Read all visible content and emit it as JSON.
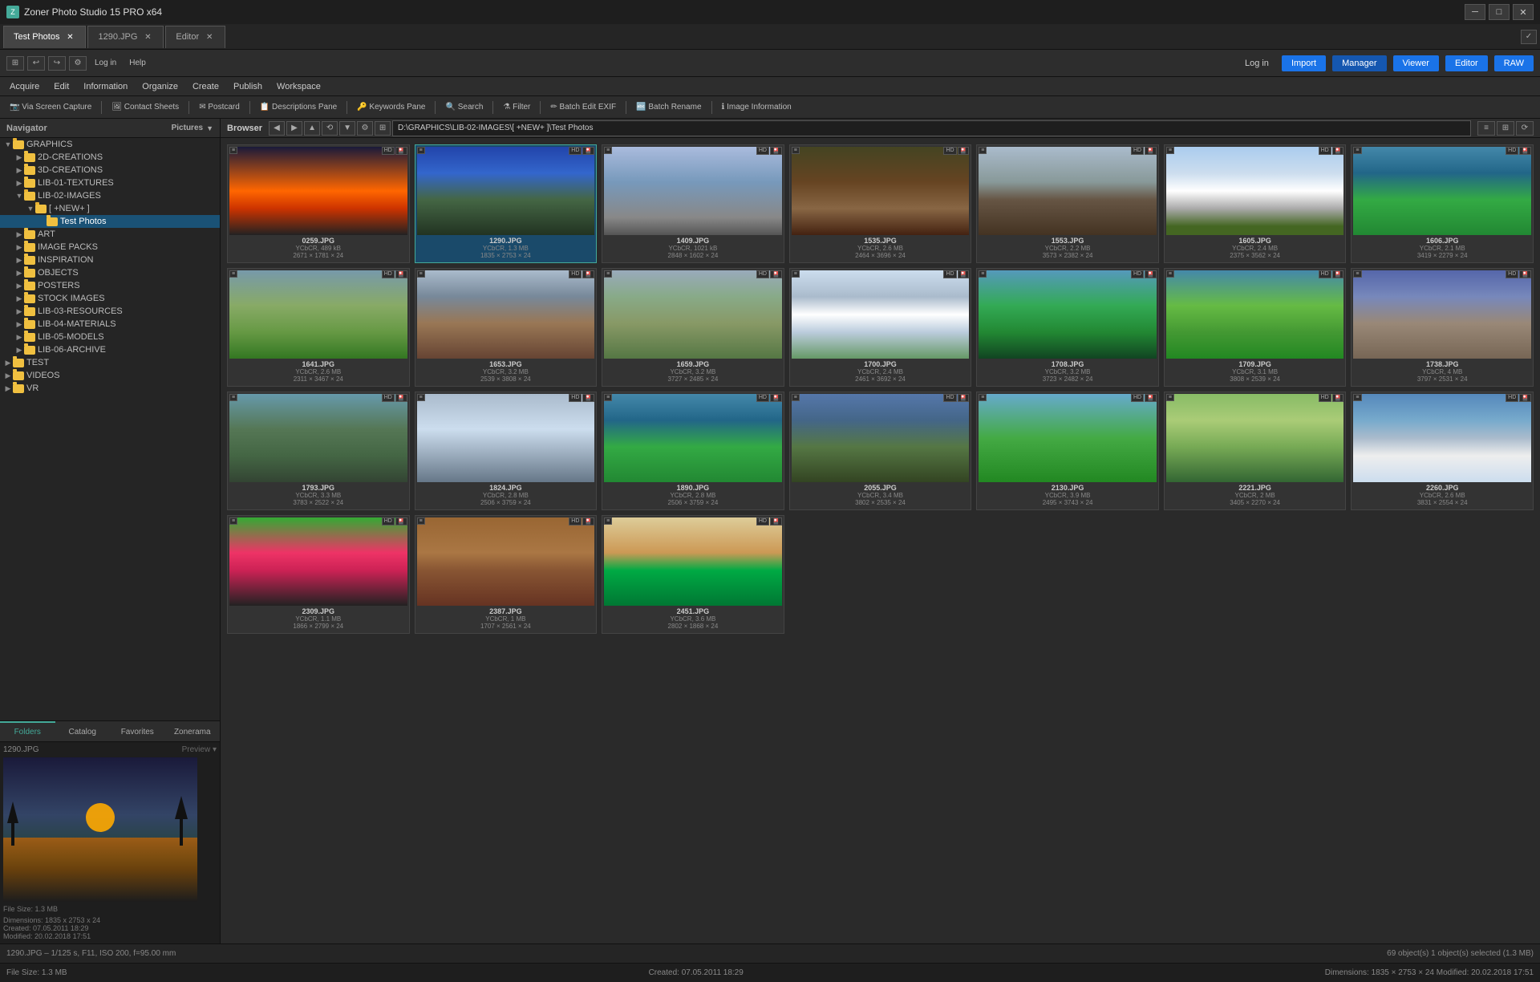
{
  "app": {
    "title": "Zoner Photo Studio 15 PRO x64",
    "icon": "Z"
  },
  "titlebar": {
    "minimize": "─",
    "maximize": "□",
    "close": "✕"
  },
  "tabs": [
    {
      "id": "test-photos",
      "label": "Test Photos",
      "active": true
    },
    {
      "id": "1290jpg",
      "label": "1290.JPG",
      "active": false
    },
    {
      "id": "editor",
      "label": "Editor",
      "active": false
    }
  ],
  "top_toolbar": {
    "log_in": "Log in",
    "import": "Import",
    "manager": "Manager",
    "viewer": "Viewer",
    "editor": "Editor",
    "raw": "RAW"
  },
  "menubar": {
    "items": [
      "Acquire",
      "Edit",
      "Information",
      "Organize",
      "Create",
      "Publish",
      "Workspace"
    ]
  },
  "action_toolbar": {
    "items": [
      "Via Screen Capture",
      "Contact Sheets",
      "Postcard",
      "Descriptions Pane",
      "Keywords Pane",
      "Search",
      "Filter",
      "Batch Edit EXIF",
      "Batch Rename",
      "Image Information"
    ]
  },
  "sidebar": {
    "navigator_label": "Navigator",
    "pictures_label": "Pictures",
    "tree": [
      {
        "indent": 0,
        "label": "GRAPHICS",
        "expanded": true,
        "selected": false,
        "arrow": "▼"
      },
      {
        "indent": 1,
        "label": "2D-CREATIONS",
        "expanded": false,
        "selected": false,
        "arrow": "▶"
      },
      {
        "indent": 1,
        "label": "3D-CREATIONS",
        "expanded": false,
        "selected": false,
        "arrow": "▶"
      },
      {
        "indent": 1,
        "label": "LIB-01-TEXTURES",
        "expanded": false,
        "selected": false,
        "arrow": "▶"
      },
      {
        "indent": 1,
        "label": "LIB-02-IMAGES",
        "expanded": true,
        "selected": false,
        "arrow": "▼"
      },
      {
        "indent": 2,
        "label": "[ +NEW+ ]",
        "expanded": true,
        "selected": false,
        "arrow": "▼"
      },
      {
        "indent": 3,
        "label": "Test Photos",
        "expanded": false,
        "selected": true,
        "arrow": ""
      },
      {
        "indent": 1,
        "label": "ART",
        "expanded": false,
        "selected": false,
        "arrow": "▶"
      },
      {
        "indent": 1,
        "label": "IMAGE PACKS",
        "expanded": false,
        "selected": false,
        "arrow": "▶"
      },
      {
        "indent": 1,
        "label": "INSPIRATION",
        "expanded": false,
        "selected": false,
        "arrow": "▶"
      },
      {
        "indent": 1,
        "label": "OBJECTS",
        "expanded": false,
        "selected": false,
        "arrow": "▶"
      },
      {
        "indent": 1,
        "label": "POSTERS",
        "expanded": false,
        "selected": false,
        "arrow": "▶"
      },
      {
        "indent": 1,
        "label": "STOCK IMAGES",
        "expanded": false,
        "selected": false,
        "arrow": "▶"
      },
      {
        "indent": 1,
        "label": "LIB-03-RESOURCES",
        "expanded": false,
        "selected": false,
        "arrow": "▶"
      },
      {
        "indent": 1,
        "label": "LIB-04-MATERIALS",
        "expanded": false,
        "selected": false,
        "arrow": "▶"
      },
      {
        "indent": 1,
        "label": "LIB-05-MODELS",
        "expanded": false,
        "selected": false,
        "arrow": "▶"
      },
      {
        "indent": 1,
        "label": "LIB-06-ARCHIVE",
        "expanded": false,
        "selected": false,
        "arrow": "▶"
      },
      {
        "indent": 0,
        "label": "TEST",
        "expanded": false,
        "selected": false,
        "arrow": "▶"
      },
      {
        "indent": 0,
        "label": "VIDEOS",
        "expanded": false,
        "selected": false,
        "arrow": "▶"
      },
      {
        "indent": 0,
        "label": "VR",
        "expanded": false,
        "selected": false,
        "arrow": "▶"
      }
    ],
    "tabs": [
      "Folders",
      "Catalog",
      "Favorites",
      "Zonerama"
    ],
    "active_tab": "Folders",
    "preview_label": "1290.JPG",
    "preview_toggle": "Preview ▾",
    "preview_info": {
      "file_size": "File Size: 1.3 MB",
      "dimensions": "Dimensions: 1835 x 2753 x 24",
      "created": "Created: 07.05.2011 18:29",
      "modified": "Modified: 20.02.2018 17:51"
    }
  },
  "browser": {
    "label": "Browser",
    "address": "D:\\GRAPHICS\\LIB-02-IMAGES\\[ +NEW+ ]\\Test Photos",
    "nav_buttons": [
      "◀",
      "▶",
      "▲",
      "⟲",
      "▼",
      "⚙",
      "⊞"
    ]
  },
  "thumbnails": [
    {
      "name": "0259.JPG",
      "meta1": "YCbCR, 489 kB",
      "meta2": "2671 × 1781 × 24",
      "img_class": "img-sunset",
      "selected": false
    },
    {
      "name": "1290.JPG",
      "meta1": "YCbCR, 1.3 MB",
      "meta2": "1835 × 2753 × 24",
      "img_class": "img-lake",
      "selected": true
    },
    {
      "name": "1409.JPG",
      "meta1": "YCbCR, 1021 kB",
      "meta2": "2848 × 1602 × 24",
      "img_class": "img-plane",
      "selected": false
    },
    {
      "name": "1535.JPG",
      "meta1": "YCbCR, 2.6 MB",
      "meta2": "2464 × 3696 × 24",
      "img_class": "img-cafe",
      "selected": false
    },
    {
      "name": "1553.JPG",
      "meta1": "YCbCR, 2.2 MB",
      "meta2": "3573 × 2382 × 24",
      "img_class": "img-city",
      "selected": false
    },
    {
      "name": "1605.JPG",
      "meta1": "YCbCR, 2.4 MB",
      "meta2": "2375 × 3562 × 24",
      "img_class": "img-mountain-snow",
      "selected": false
    },
    {
      "name": "1606.JPG",
      "meta1": "YCbCR, 2.1 MB",
      "meta2": "3419 × 2279 × 24",
      "img_class": "img-mountain-green",
      "selected": false
    },
    {
      "name": "1641.JPG",
      "meta1": "YCbCR, 2.6 MB",
      "meta2": "2311 × 3467 × 24",
      "img_class": "img-road",
      "selected": false
    },
    {
      "name": "1653.JPG",
      "meta1": "YCbCR, 3.2 MB",
      "meta2": "2539 × 3808 × 24",
      "img_class": "img-mountain-brown",
      "selected": false
    },
    {
      "name": "1659.JPG",
      "meta1": "YCbCR, 3.2 MB",
      "meta2": "3727 × 2485 × 24",
      "img_class": "img-mountain-path",
      "selected": false
    },
    {
      "name": "1700.JPG",
      "meta1": "YCbCR, 2.4 MB",
      "meta2": "2461 × 3692 × 24",
      "img_class": "img-mountain-white",
      "selected": false
    },
    {
      "name": "1708.JPG",
      "meta1": "YCbCR, 3.2 MB",
      "meta2": "3723 × 2482 × 24",
      "img_class": "img-green-valley",
      "selected": false
    },
    {
      "name": "1709.JPG",
      "meta1": "YCbCR, 3.1 MB",
      "meta2": "3808 × 2539 × 24",
      "img_class": "img-valley-hut",
      "selected": false
    },
    {
      "name": "1738.JPG",
      "meta1": "YCbCR, 4 MB",
      "meta2": "3797 × 2531 × 24",
      "img_class": "img-crowd",
      "selected": false
    },
    {
      "name": "1793.JPG",
      "meta1": "YCbCR, 3.3 MB",
      "meta2": "3783 × 2522 × 24",
      "img_class": "img-trees",
      "selected": false
    },
    {
      "name": "1824.JPG",
      "meta1": "YCbCR, 2.8 MB",
      "meta2": "2506 × 3759 × 24",
      "img_class": "img-clouds",
      "selected": false
    },
    {
      "name": "1890.JPG",
      "meta1": "YCbCR, 2.8 MB",
      "meta2": "2506 × 3759 × 24",
      "img_class": "img-mountain-green",
      "selected": false
    },
    {
      "name": "2055.JPG",
      "meta1": "YCbCR, 3.4 MB",
      "meta2": "3802 × 2535 × 24",
      "img_class": "img-machu",
      "selected": false
    },
    {
      "name": "2130.JPG",
      "meta1": "YCbCR, 3.9 MB",
      "meta2": "2495 × 3743 × 24",
      "img_class": "img-tree-plain",
      "selected": false
    },
    {
      "name": "2221.JPG",
      "meta1": "YCbCR, 2 MB",
      "meta2": "3405 × 2270 × 24",
      "img_class": "img-alpaca",
      "selected": false
    },
    {
      "name": "2260.JPG",
      "meta1": "YCbCR, 2.6 MB",
      "meta2": "3831 × 2554 × 24",
      "img_class": "img-church",
      "selected": false
    },
    {
      "name": "2309.JPG",
      "meta1": "YCbCR, 1.1 MB",
      "meta2": "1866 × 2799 × 24",
      "img_class": "img-flower",
      "selected": false
    },
    {
      "name": "2387.JPG",
      "meta1": "YCbCR, 1 MB",
      "meta2": "1707 × 2561 × 24",
      "img_class": "img-ruins",
      "selected": false
    },
    {
      "name": "2451.JPG",
      "meta1": "YCbCR, 3.6 MB",
      "meta2": "2802 × 1868 × 24",
      "img_class": "img-butterfly",
      "selected": false
    }
  ],
  "statusbar": {
    "left": "File Size: 1.3 MB",
    "middle": "Created: 07.05.2011 18:29",
    "right": "Dimensions: 1835 × 2753 × 24   Modified: 20.02.2018 17:51"
  },
  "statusbar2": {
    "left": "1290.JPG – 1/125 s, F11, ISO 200, f=95.00 mm",
    "middle": "",
    "right": "69 object(s)    1 object(s) selected (1.3 MB)"
  }
}
